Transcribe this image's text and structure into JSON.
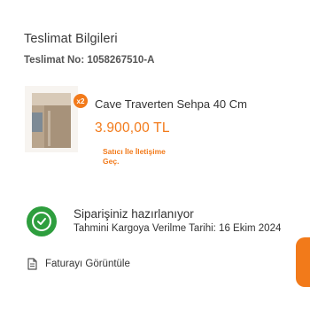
{
  "header": {
    "title": "Teslimat Bilgileri",
    "delivery_no": "Teslimat No: 1058267510-A"
  },
  "product": {
    "name": "Cave Traverten Sehpa 40 Cm",
    "price": "3.900,00 TL",
    "quantity_badge": "x2",
    "seller_contact": "Satıcı İle İletişime Geç."
  },
  "status": {
    "title": "Siparişiniz hazırlanıyor",
    "subtitle": "Tahmini Kargoya Verilme Tarihi: 16 Ekim 2024",
    "icon": "check-circle-icon",
    "color": "#2e9e3e"
  },
  "invoice": {
    "label": "Faturayı Görüntüle",
    "icon": "document-icon"
  },
  "colors": {
    "accent": "#f27a1a",
    "success": "#2e9e3e"
  }
}
